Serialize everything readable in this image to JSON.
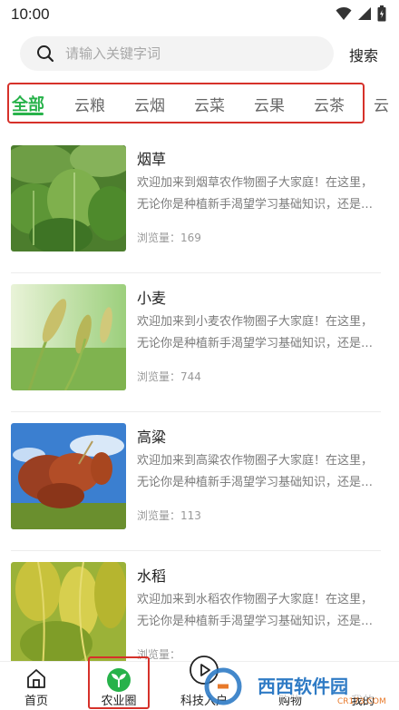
{
  "status_bar": {
    "time": "10:00"
  },
  "search": {
    "placeholder": "请输入关键字词",
    "button_label": "搜索"
  },
  "tabs": [
    "全部",
    "云粮",
    "云烟",
    "云菜",
    "云果",
    "云茶",
    "云"
  ],
  "active_tab": 0,
  "items": [
    {
      "title": "烟草",
      "desc": "欢迎加来到烟草农作物圈子大家庭！在这里，无论你是种植新手渴望学习基础知识，还是…",
      "views_label": "浏览量：",
      "views": "169",
      "image": "tobacco"
    },
    {
      "title": "小麦",
      "desc": "欢迎加来到小麦农作物圈子大家庭！在这里，无论你是种植新手渴望学习基础知识，还是…",
      "views_label": "浏览量：",
      "views": "744",
      "image": "wheat"
    },
    {
      "title": "高粱",
      "desc": "欢迎加来到高粱农作物圈子大家庭！在这里，无论你是种植新手渴望学习基础知识，还是…",
      "views_label": "浏览量：",
      "views": "113",
      "image": "sorghum"
    },
    {
      "title": "水稻",
      "desc": "欢迎加来到水稻农作物圈子大家庭！在这里，无论你是种植新手渴望学习基础知识，还是…",
      "views_label": "浏览量：",
      "views": "",
      "image": "rice"
    }
  ],
  "bottom_nav": [
    {
      "label": "首页",
      "icon": "home-icon"
    },
    {
      "label": "农业圈",
      "icon": "sprout-icon"
    },
    {
      "label": "科技入户",
      "icon": "play-circle-icon"
    },
    {
      "label": "购物",
      "icon": "cart-icon"
    },
    {
      "label": "我的",
      "icon": "user-icon"
    }
  ],
  "watermark": {
    "text": "西西软件园",
    "sub": "CR173.COM"
  },
  "colors": {
    "accent": "#27b24a",
    "highlight": "#d6312a"
  }
}
